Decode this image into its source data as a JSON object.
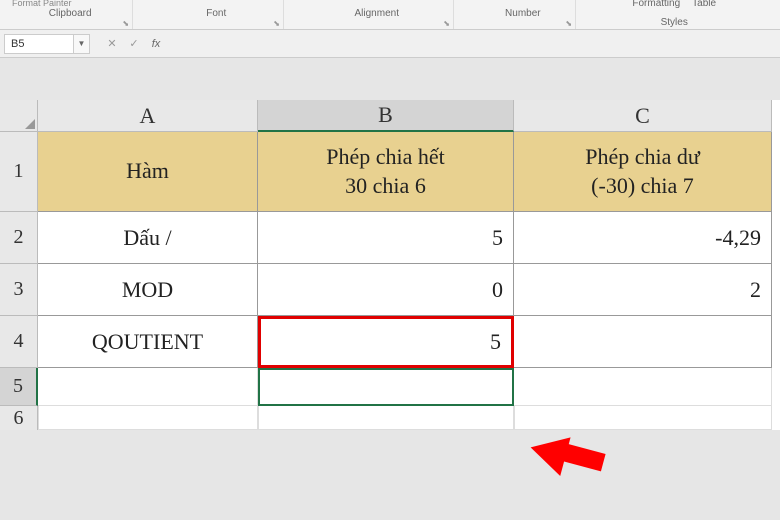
{
  "ribbon": {
    "format_painter": "Format Painter",
    "clipboard": "Clipboard",
    "font": "Font",
    "alignment": "Alignment",
    "number": "Number",
    "formatting": "Formatting",
    "table": "Table",
    "styles": "Styles"
  },
  "name_box": "B5",
  "columns": [
    "A",
    "B",
    "C"
  ],
  "rows": [
    "1",
    "2",
    "3",
    "4",
    "5",
    "6"
  ],
  "headers": {
    "a": "Hàm",
    "b_line1": "Phép chia hết",
    "b_line2": "30 chia 6",
    "c_line1": "Phép chia dư",
    "c_line2": "(-30) chia 7"
  },
  "data": {
    "a2": "Dấu /",
    "b2": "5",
    "c2": "-4,29",
    "a3": "MOD",
    "b3": "0",
    "c3": "2",
    "a4": "QOUTIENT",
    "b4": "5",
    "c4": ""
  },
  "active_cell": "B5"
}
